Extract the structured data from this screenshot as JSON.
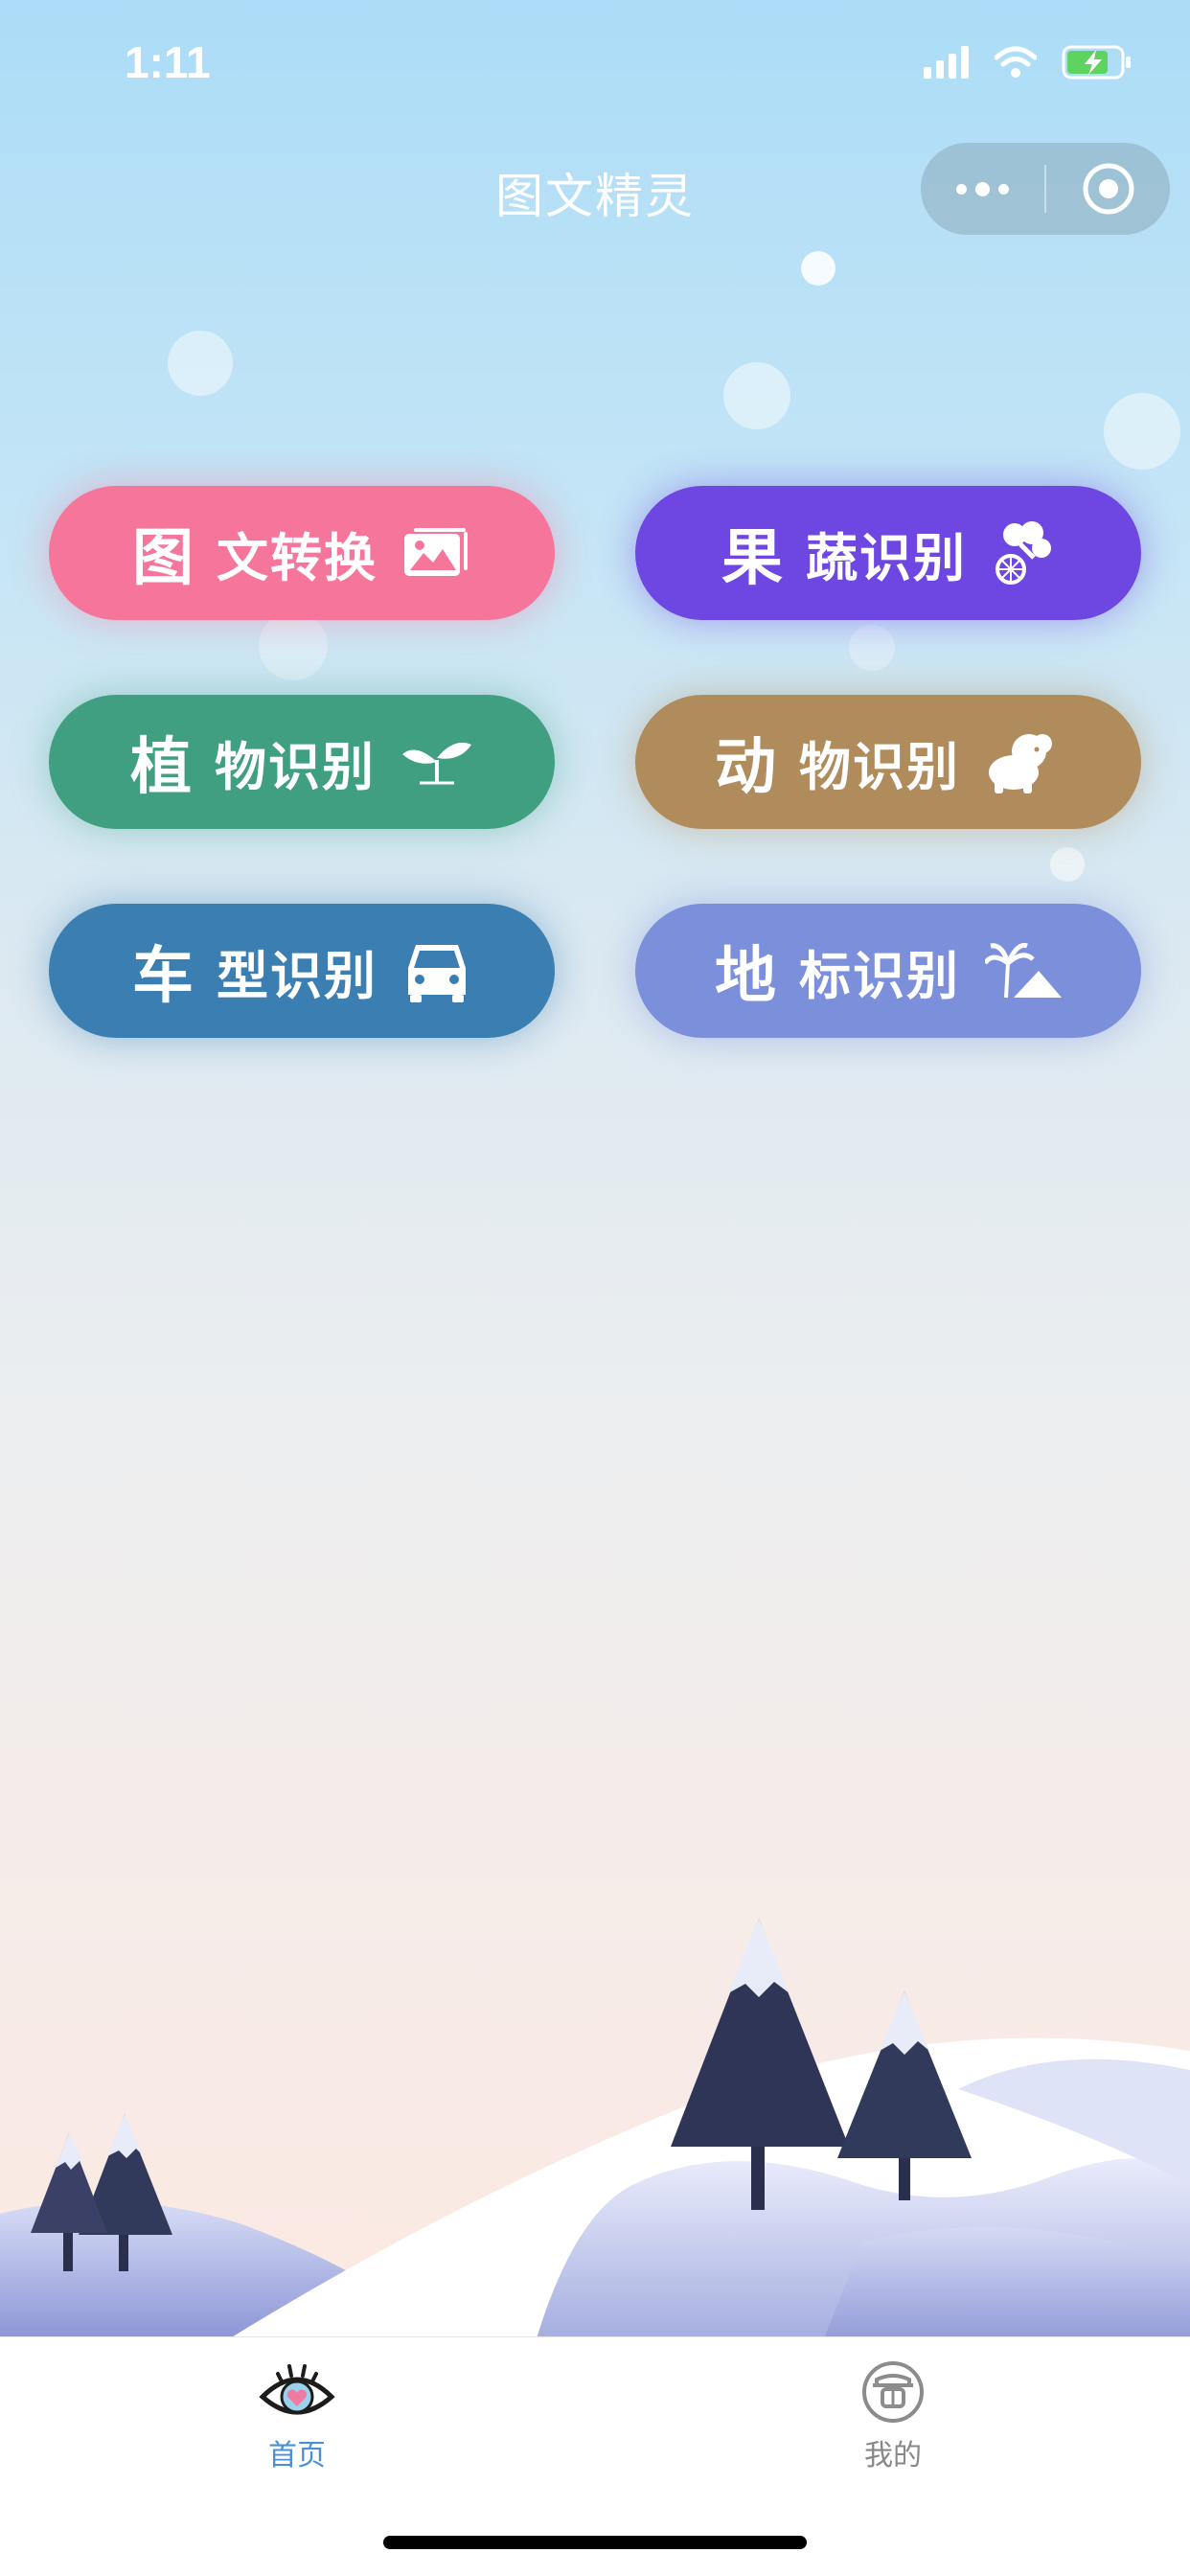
{
  "status_bar": {
    "time": "1:11"
  },
  "nav": {
    "title": "图文精灵"
  },
  "buttons": [
    {
      "big": "图",
      "rest": "文转换",
      "icon": "image-icon"
    },
    {
      "big": "果",
      "rest": "蔬识别",
      "icon": "fruit-icon"
    },
    {
      "big": "植",
      "rest": "物识别",
      "icon": "sprout-icon"
    },
    {
      "big": "动",
      "rest": "物识别",
      "icon": "animal-icon"
    },
    {
      "big": "车",
      "rest": "型识别",
      "icon": "car-icon"
    },
    {
      "big": "地",
      "rest": "标识别",
      "icon": "landmark-icon"
    }
  ],
  "colors": {
    "pink": "#f6759b",
    "purple": "#6e46e2",
    "green": "#3f9f80",
    "brown": "#b08b5b",
    "blue": "#3b7eb1",
    "lavender": "#7b8fda",
    "tab_active": "#4a90d9",
    "tab_inactive": "#888888"
  },
  "tabbar": {
    "tabs": [
      {
        "label": "首页",
        "icon": "eye-heart-icon",
        "active": true
      },
      {
        "label": "我的",
        "icon": "profile-icon",
        "active": false
      }
    ]
  }
}
